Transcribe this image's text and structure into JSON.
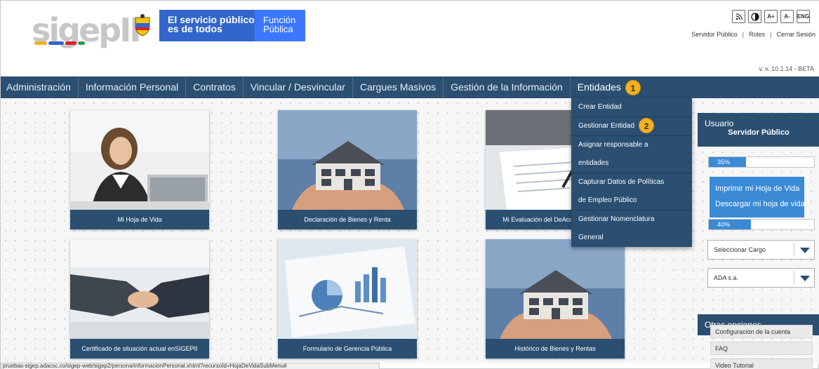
{
  "header": {
    "logo_text": "sigepII",
    "gov_line1": "El servicio público",
    "gov_line2": "es de todos",
    "fp_line1": "Función",
    "fp_line2": "Pública",
    "tools": [
      "RSS",
      "",
      "A+",
      "A-",
      "ENG"
    ],
    "links": [
      "Servidor Público",
      "Roles",
      "Cerrar Sesión"
    ],
    "version": "v. v. 10.1.14 - BETA"
  },
  "nav": {
    "items": [
      "Administración",
      "Información Personal",
      "Contratos",
      "Vincular / Desvincular",
      "Cargues Masivos",
      "Gestión de la Información",
      "Entidades"
    ],
    "step1": "1"
  },
  "dropdown": {
    "items": [
      "Crear Entidad",
      "Gestionar Entidad",
      "Asignar responsable a",
      "entidades",
      "Capturar Datos de Políticas",
      "de Empleo Público",
      "Gestionar Nomenclatura",
      "General"
    ],
    "step2": "2"
  },
  "tiles": [
    "Mi Hoja de Vida",
    "Declaración de Bienes y Renta",
    "Mi Evaluación del De",
    "Acuerdos de Ge",
    "Certificado de situación actual en",
    "SIGEPII",
    "Formulario de Gerencia Pública",
    "Histórico de Bienes y Rentas"
  ],
  "panel": {
    "title": "Usuario",
    "subtitle": "Servidor Público",
    "progress1": "35%",
    "progress1_value": 35,
    "btn_print": "Imprimir mi Hoja de Vida",
    "btn_download": "Descargar mi hoja de vida",
    "progress2": "40%",
    "progress2_value": 40,
    "select_cargo": "Seleccionar Cargo",
    "select_entity": "ADA s.a.",
    "other_title": "Otras opciones",
    "options": [
      "Configuración de la cuenta",
      "FAQ",
      "Video Tutorial"
    ]
  },
  "statusbar": "pruebas-sigep.adacsc.co/sigep-web/sigep2/persona/informacionPersonal.xhtml?recursoId=HojaDeVidaSubMenu#",
  "colors": {
    "nav": "#2a4f71",
    "accent": "#3a8ad6",
    "step_badge": "#f2b024",
    "gov_blue": "#3366cc"
  }
}
